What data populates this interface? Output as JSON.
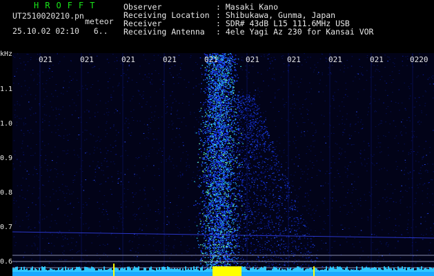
{
  "app": {
    "name": "HROFFT"
  },
  "file": {
    "name": "UT2510020210.pn",
    "tag": "meteor",
    "timestamp": "25.10.02 02:10",
    "count": "6.."
  },
  "info": [
    {
      "label": "Observer",
      "value": ": Masaki Kano"
    },
    {
      "label": "Receiving Location",
      "value": ": Shibukawa, Gunma, Japan"
    },
    {
      "label": "Receiver",
      "value": ": SDR# 43dB L15 111.6MHz USB"
    },
    {
      "label": "Receiving Antenna",
      "value": ": 4ele Yagi Az 230 for Kansai VOR"
    }
  ],
  "axis": {
    "y_unit": "kHz",
    "y_ticks": [
      "1.1",
      "1.0",
      "0.9",
      "0.8",
      "0.7",
      "0.6"
    ],
    "x_ticks": [
      "021",
      "021",
      "021",
      "021",
      "021",
      "021",
      "021",
      "021",
      "021",
      "0220"
    ]
  },
  "colors": {
    "title": "#19e619",
    "background": "#020318",
    "echo": "#3cf0f0",
    "baseline": "#2ec8ff",
    "marker": "#ffff00"
  }
}
